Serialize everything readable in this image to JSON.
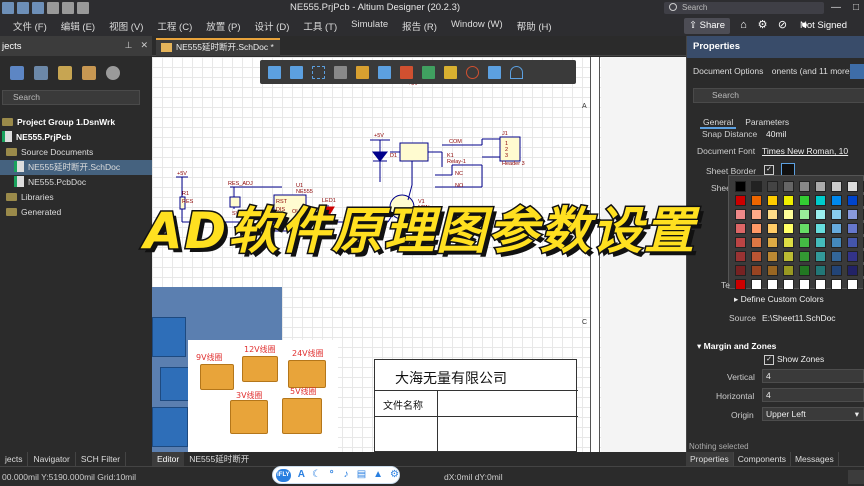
{
  "window": {
    "title": "NE555.PrjPcb - Altium Designer (20.2.3)",
    "search_placeholder": "Search",
    "minimize": "—",
    "maximize": "□",
    "close": "✕"
  },
  "menu": {
    "items": [
      "文件 (F)",
      "编辑 (E)",
      "视图 (V)",
      "工程 (C)",
      "放置 (P)",
      "设计 (D)",
      "工具 (T)",
      "Simulate",
      "报告 (R)",
      "Window (W)",
      "帮助 (H)"
    ],
    "share_label": "Share",
    "not_signed_in": "Not Signed"
  },
  "projects_panel": {
    "title": "jects",
    "search_placeholder": "Search",
    "tree": [
      {
        "label": "Project Group 1.DsnWrk",
        "kind": "group"
      },
      {
        "label": "NE555.PrjPcb",
        "kind": "project"
      },
      {
        "label": "Source Documents",
        "kind": "folder"
      },
      {
        "label": "NE555延时断开.SchDoc",
        "kind": "doc",
        "selected": true
      },
      {
        "label": "NE555.PcbDoc",
        "kind": "doc"
      },
      {
        "label": "Libraries",
        "kind": "folder"
      },
      {
        "label": "Generated",
        "kind": "folder"
      }
    ],
    "bottom_tabs": [
      "jects",
      "Navigator",
      "SCH Filter"
    ]
  },
  "document": {
    "tab_label": "NE555延时断开.SchDoc *",
    "editor_tabs": [
      "Editor",
      "NE555延时断开"
    ],
    "title_block": {
      "company": "大海无量有限公司",
      "file_name_label": "文件名称"
    },
    "relay_photo_labels": [
      "9V线圈",
      "12V线圈",
      "24V线圈",
      "3V线圈",
      "5V线圈"
    ],
    "schematic_labels": {
      "v1": "+5V",
      "v2": "+5V",
      "v3": "+5V",
      "r1": "R1",
      "r1_val": "RES",
      "res_adj": "RES_ADJ",
      "svr1": "SVR1",
      "u1": "U1",
      "u1_part": "NE555",
      "rst": "RST",
      "dis": "DIS",
      "out": "OUT",
      "led1": "LED1",
      "r2": "R2",
      "v1q": "V1",
      "npn": "NPN",
      "d1": "D1",
      "k1": "K1",
      "relay": "Relay-1",
      "com": "COM",
      "nc": "NC",
      "no": "NO",
      "j1": "J1",
      "header": "Header 3",
      "pin1": "1",
      "pin2": "2",
      "pin3": "3",
      "border_a": "A",
      "border_b": "B",
      "border_c": "C"
    }
  },
  "banner": {
    "text": "AD软件原理图参数设置"
  },
  "properties_panel": {
    "title": "Properties",
    "doc_options": "Document Options",
    "components_hint": "onents (and 11 more)",
    "search_placeholder": "Search",
    "tabs": [
      "General",
      "Parameters"
    ],
    "snap_distance_label": "Snap Distance",
    "snap_distance_value": "40mil",
    "document_font_label": "Document Font",
    "document_font_value": "Times New Roman, 10",
    "sheet_border_label": "Sheet Border",
    "sheet_color_label": "Shee",
    "te_label": "Te",
    "define_custom_colors": "Define Custom Colors",
    "source_label": "Source",
    "source_value": "E:\\Sheet11.SchDoc",
    "margin_zones_title": "Margin and Zones",
    "show_zones_label": "Show Zones",
    "vertical_label": "Vertical",
    "vertical_value": "4",
    "horizontal_label": "Horizontal",
    "horizontal_value": "4",
    "origin_label": "Origin",
    "origin_value": "Upper Left",
    "status": "Nothing selected",
    "bottom_tabs": [
      "Properties",
      "Components",
      "Messages"
    ]
  },
  "statusbar": {
    "coords": "00.000mil Y:5190.000mil   Grid:10mil",
    "delta": "dX:0mil dY:0mil"
  },
  "ifly": {
    "logo": "iFLY"
  },
  "colors": {
    "accent": "#e8a33c",
    "selected_row": "#45627f",
    "properties_header": "#394c6a",
    "banner_text": "#ffe020"
  }
}
